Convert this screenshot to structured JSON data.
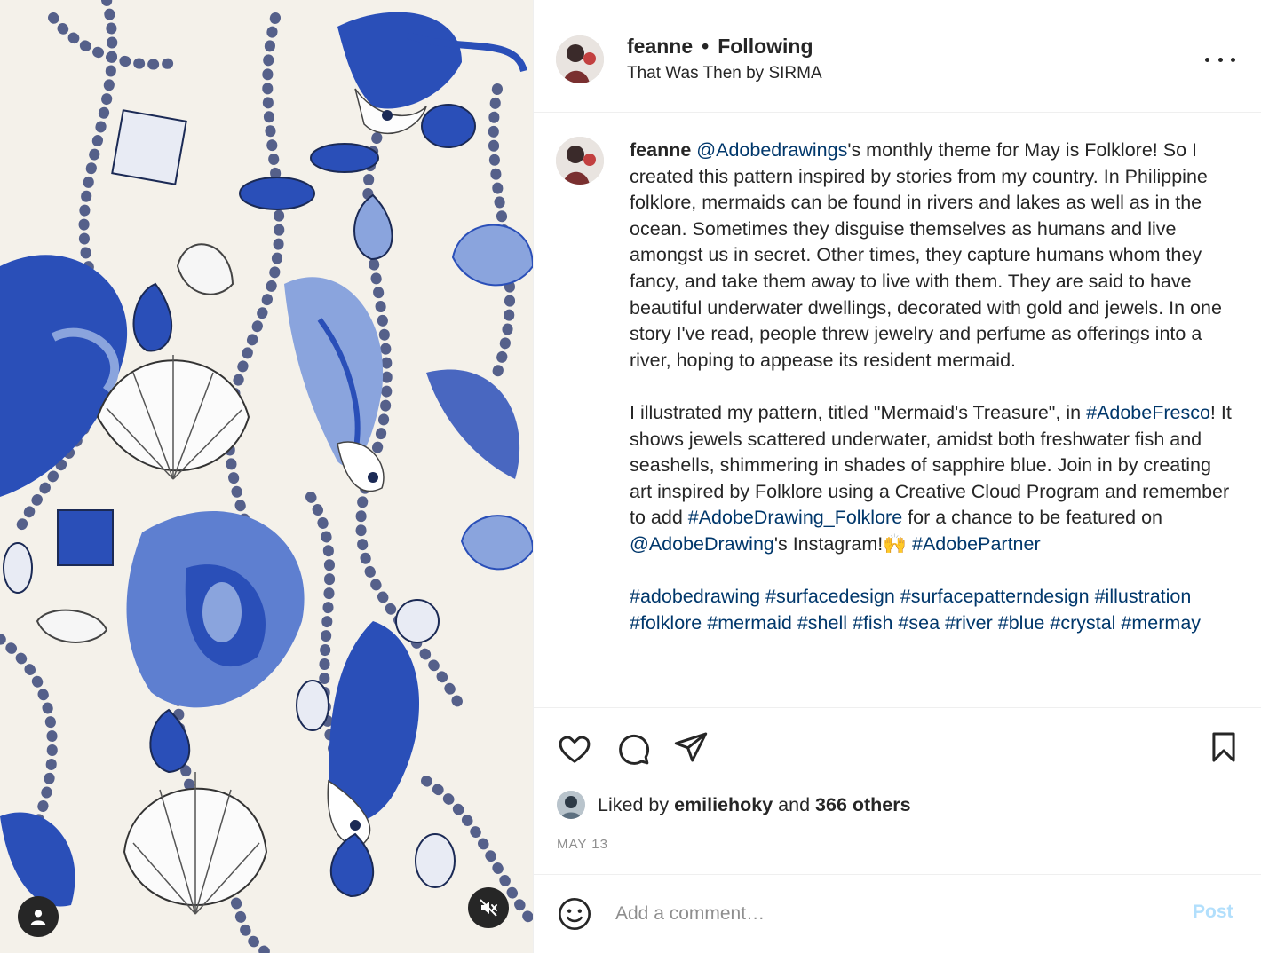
{
  "colors": {
    "accent_link": "#00376b",
    "post_disabled": "#b2dffc",
    "muted": "#8e8e8e",
    "pattern_blue": "#2a4fb8",
    "pattern_light_blue": "#8aa4dd",
    "pattern_background": "#f4f1ea"
  },
  "media": {
    "tag_icon": "user-tag-icon",
    "mute_icon": "speaker-muted-icon"
  },
  "header": {
    "username": "feanne",
    "separator": "•",
    "follow_status": "Following",
    "audio": "That Was Then by SIRMA",
    "more_icon": "ellipsis-icon"
  },
  "caption": {
    "username": "feanne",
    "p1": {
      "mention": "@Adobedrawings",
      "text": "'s monthly theme for May is Folklore! So I created this pattern inspired by stories from my country. In Philippine folklore, mermaids can be found in rivers and lakes as well as in the ocean. Sometimes they disguise themselves as humans and live amongst us in secret. Other times, they capture humans whom they fancy, and take them away to live with them. They are said to have beautiful underwater dwellings, decorated with gold and jewels. In one story I've read, people threw jewelry and perfume as offerings into a river, hoping to appease its resident mermaid."
    },
    "p2": {
      "t1": "I illustrated my pattern, titled \"Mermaid's Treasure\", in ",
      "tag1": "#AdobeFresco",
      "t2": "! It shows jewels scattered underwater, amidst both freshwater fish and seashells, shimmering in shades of sapphire blue. Join in by creating art inspired by Folklore using a Creative Cloud Program and remember to add ",
      "tag2": "#AdobeDrawing_Folklore",
      "t3": " for a chance to be featured on ",
      "mention2": "@AdobeDrawing",
      "t4": "'s Instagram!🙌 ",
      "tag3": "#AdobePartner"
    },
    "hashtags": [
      "#adobedrawing",
      "#surfacedesign",
      "#surfacepatterndesign",
      "#illustration",
      "#folklore",
      "#mermaid",
      "#shell",
      "#fish",
      "#sea",
      "#river",
      "#blue",
      "#crystal",
      "#mermay"
    ]
  },
  "actions": {
    "like_icon": "heart-icon",
    "comment_icon": "comment-bubble-icon",
    "share_icon": "paper-plane-icon",
    "save_icon": "bookmark-icon"
  },
  "likes": {
    "prefix": "Liked by ",
    "user": "emiliehoky",
    "joiner": " and ",
    "others": "366 others"
  },
  "date": "MAY 13",
  "comment": {
    "emoji_icon": "smiley-icon",
    "placeholder": "Add a comment…",
    "post_label": "Post"
  }
}
